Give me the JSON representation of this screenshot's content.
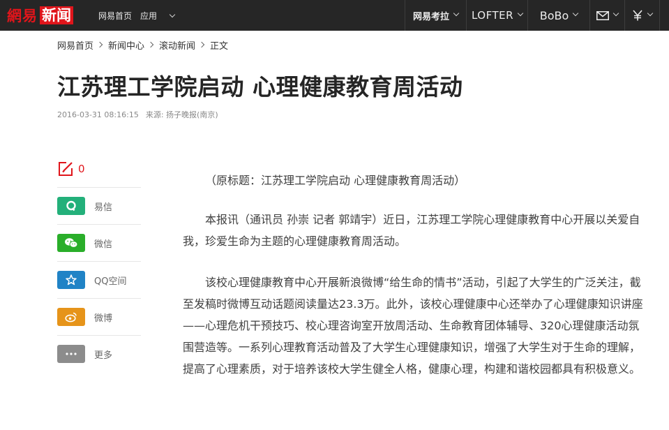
{
  "topbar": {
    "logo_part1": "網易",
    "logo_part2": "新闻",
    "nav_left": [
      {
        "label": "网易首页"
      },
      {
        "label": "应用"
      }
    ],
    "nav_right": {
      "kaola": "网易考拉",
      "lofter": "LOFTER",
      "bobo": "BoBo"
    },
    "colors": {
      "bar": "#262626",
      "brand": "#e0151b"
    },
    "icons": [
      "mail-icon",
      "money-icon"
    ]
  },
  "breadcrumb": [
    "网易首页",
    "新闻中心",
    "滚动新闻",
    "正文"
  ],
  "article": {
    "title": "江苏理工学院启动 心理健康教育周活动",
    "date": "2016-03-31 08:16:15",
    "source": "来源: 扬子晚报(南京)",
    "paragraphs": [
      "（原标题：江苏理工学院启动 心理健康教育周活动）",
      "本报讯（通讯员 孙崇 记者 郭靖宇）近日，江苏理工学院心理健康教育中心开展以关爱自我，珍爱生命为主题的心理健康教育周活动。",
      "该校心理健康教育中心开展新浪微博“给生命的情书”活动，引起了大学生的广泛关注，截至发稿时微博互动话题阅读量达23.3万。此外，该校心理健康中心还举办了心理健康知识讲座——心理危机干预技巧、校心理咨询室开放周活动、生命教育团体辅导、320心理健康活动氛围营造等。一系列心理教育活动普及了大学生心理健康知识，增强了大学生对于生命的理解，提高了心理素质，对于培养该校大学生健全人格，健康心理，构建和谐校园都具有积极意义。"
    ]
  },
  "share": {
    "comment_count": "0",
    "items": [
      {
        "label": "易信",
        "color": "#23b07a",
        "icon": "yixin-icon"
      },
      {
        "label": "微信",
        "color": "#2aae2a",
        "icon": "wechat-icon"
      },
      {
        "label": "QQ空间",
        "color": "#2083c6",
        "icon": "qzone-star-icon"
      },
      {
        "label": "微博",
        "color": "#e6941a",
        "icon": "weibo-icon"
      },
      {
        "label": "更多",
        "color": "#8c8c8c",
        "icon": "more-dots-icon"
      }
    ]
  }
}
